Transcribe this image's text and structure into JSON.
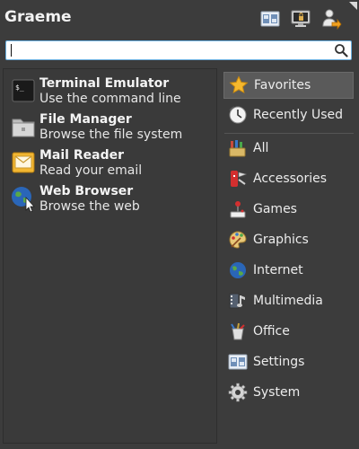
{
  "header": {
    "username": "Graeme",
    "buttons": [
      {
        "name": "settings-manager-icon"
      },
      {
        "name": "lock-screen-icon"
      },
      {
        "name": "log-out-icon"
      }
    ]
  },
  "search": {
    "value": "",
    "placeholder": ""
  },
  "favorites": [
    {
      "title": "Terminal Emulator",
      "description": "Use the command line",
      "icon": "terminal-icon"
    },
    {
      "title": "File Manager",
      "description": "Browse the file system",
      "icon": "folder-icon"
    },
    {
      "title": "Mail Reader",
      "description": "Read your email",
      "icon": "mail-icon"
    },
    {
      "title": "Web Browser",
      "description": "Browse the web",
      "icon": "globe-icon"
    }
  ],
  "categories": [
    {
      "label": "Favorites",
      "icon": "star-icon",
      "selected": true
    },
    {
      "label": "Recently Used",
      "icon": "clock-icon",
      "selected": false
    },
    {
      "label": "All",
      "icon": "all-apps-icon",
      "selected": false
    },
    {
      "label": "Accessories",
      "icon": "accessories-icon",
      "selected": false
    },
    {
      "label": "Games",
      "icon": "joystick-icon",
      "selected": false
    },
    {
      "label": "Graphics",
      "icon": "palette-icon",
      "selected": false
    },
    {
      "label": "Internet",
      "icon": "globe-icon",
      "selected": false
    },
    {
      "label": "Multimedia",
      "icon": "multimedia-icon",
      "selected": false
    },
    {
      "label": "Office",
      "icon": "office-icon",
      "selected": false
    },
    {
      "label": "Settings",
      "icon": "settings-icon",
      "selected": false
    },
    {
      "label": "System",
      "icon": "gear-icon",
      "selected": false
    }
  ]
}
